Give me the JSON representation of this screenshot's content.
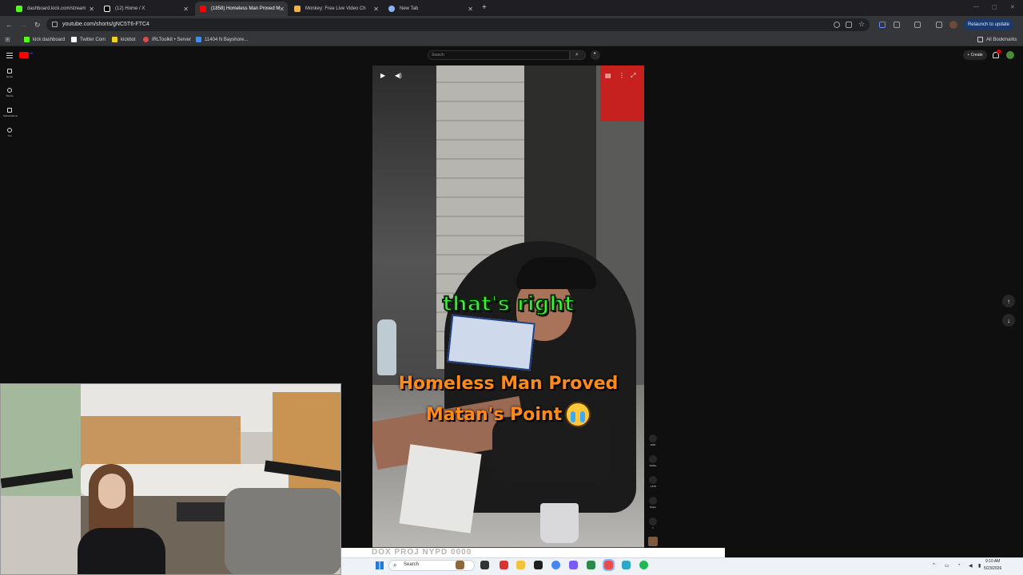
{
  "browser": {
    "tabs": [
      {
        "label": "dashboard.kick.com/stream",
        "favicon_color": "#53fc18"
      },
      {
        "label": "(12) Home / X",
        "favicon_color": "#ffffff"
      },
      {
        "label": "(1858) Homeless Man Proved M",
        "favicon_color": "#ff0000"
      },
      {
        "label": "Monkey: Free Live Video Ch",
        "favicon_color": "#f2b24a"
      },
      {
        "label": "New Tab",
        "favicon_color": "#8ab4f8"
      }
    ],
    "url": "youtube.com/shorts/gNC5T6-FTC4",
    "relaunch_label": "Relaunch to update",
    "bookmarks": [
      {
        "label": "kick dashboard",
        "color": "#53fc18"
      },
      {
        "label": "Twitter Com",
        "color": "#ffffff"
      },
      {
        "label": "kickbot",
        "color": "#f0d020"
      },
      {
        "label": "IRLToolkit • Server",
        "color": "#e04a4a"
      },
      {
        "label": "11404 N Bayshore...",
        "color": "#3a8ef0"
      }
    ],
    "all_bookmarks_label": "All Bookmarks"
  },
  "youtube": {
    "search_placeholder": "Search",
    "create_label": "+ Create",
    "sidebar": [
      {
        "label": "Home",
        "icon": "home-icon"
      },
      {
        "label": "Shorts",
        "icon": "shorts-icon"
      },
      {
        "label": "Subscriptions",
        "icon": "subscriptions-icon"
      },
      {
        "label": "You",
        "icon": "you-icon"
      }
    ],
    "short": {
      "caption_green": "that's right",
      "title_line1": "Homeless Man Proved",
      "title_line2": "Matan's Point",
      "actions": [
        {
          "name": "like",
          "count": "106K"
        },
        {
          "name": "dislike",
          "count": "Dislike"
        },
        {
          "name": "comments",
          "count": "1,578"
        },
        {
          "name": "share",
          "count": "Share"
        },
        {
          "name": "remix",
          "count": "1"
        }
      ]
    }
  },
  "overlay": {
    "text": "DOX PROJ NYPD 0000"
  },
  "taskbar": {
    "search_label": "Search",
    "time": "9:10 AM",
    "date": "5/23/2026"
  }
}
